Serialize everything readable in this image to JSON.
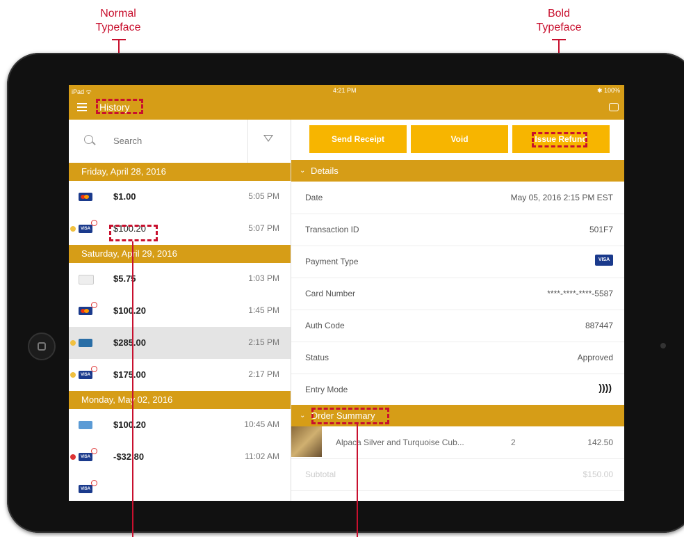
{
  "callouts": {
    "normal_typeface": [
      "Normal",
      "Typeface"
    ],
    "bold_typeface": [
      "Bold",
      "Typeface"
    ]
  },
  "status_bar": {
    "carrier": "iPad ᯤ",
    "time": "4:21 PM",
    "battery": "✱ 100%"
  },
  "app_bar": {
    "title": "History"
  },
  "search": {
    "placeholder": "Search"
  },
  "groups": [
    {
      "date": "Friday, April 28, 2016",
      "rows": [
        {
          "card": "mastercard",
          "amount": "$1.00",
          "time": "5:05 PM",
          "voided": false
        },
        {
          "card": "visa",
          "amount": "$100.20",
          "time": "5:07 PM",
          "voided": true
        }
      ]
    },
    {
      "date": "Saturday, April 29, 2016",
      "rows": [
        {
          "card": "discover",
          "amount": "$5.75",
          "time": "1:03 PM",
          "voided": false
        },
        {
          "card": "mastercard",
          "amount": "$100.20",
          "time": "1:45 PM",
          "voided": true
        },
        {
          "card": "cash",
          "amount": "$285.00",
          "time": "2:15 PM",
          "voided": false
        },
        {
          "card": "visa",
          "amount": "$175.00",
          "time": "2:17 PM",
          "voided": true
        }
      ]
    },
    {
      "date": "Monday, May 02, 2016",
      "rows": [
        {
          "card": "amex",
          "amount": "$100.20",
          "time": "10:45 AM",
          "voided": false
        },
        {
          "card": "visa",
          "amount": "-$32.80",
          "time": "11:02 AM",
          "voided": true
        }
      ]
    }
  ],
  "actions": {
    "send_receipt": "Send Receipt",
    "void": "Void",
    "issue_refund": "Issue Refund"
  },
  "details": {
    "header": "Details",
    "fields": [
      {
        "label": "Date",
        "value": "May 05, 2016 2:15 PM EST"
      },
      {
        "label": "Transaction ID",
        "value": "501F7"
      },
      {
        "label": "Payment Type",
        "value": "VISA"
      },
      {
        "label": "Card Number",
        "value": "****-****-****-5587"
      },
      {
        "label": "Auth Code",
        "value": "887447"
      },
      {
        "label": "Status",
        "value": "Approved"
      },
      {
        "label": "Entry Mode",
        "value": "))))"
      }
    ]
  },
  "order_summary": {
    "header": "Order Summary",
    "item": {
      "name": "Alpaca Silver and Turquoise Cub...",
      "qty": "2",
      "price": "142.50"
    },
    "subtotal_label": "Subtotal",
    "subtotal_value": "$150.00"
  },
  "colors": {
    "accent": "#d69d17",
    "button": "#f7b500",
    "callout": "#c8102e"
  }
}
